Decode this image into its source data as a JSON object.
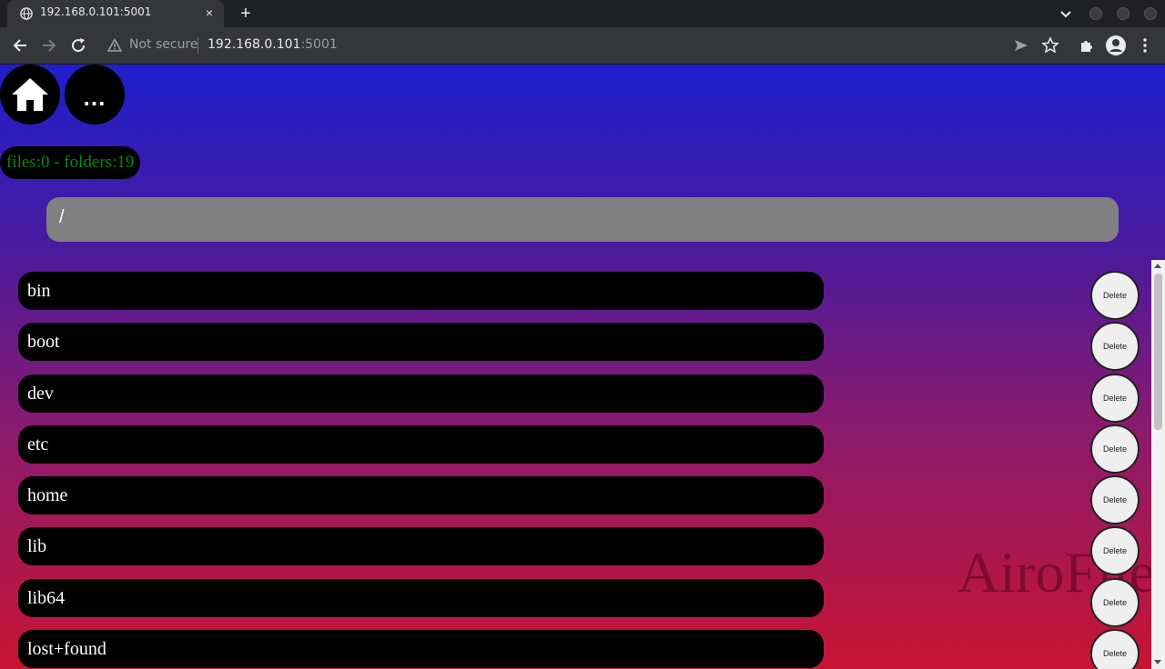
{
  "browser": {
    "tab_title": "192.168.0.101:5001",
    "tab_close": "×",
    "new_tab": "+",
    "security_label": "Not secure",
    "url_host": "192.168.0.101",
    "url_port": ":5001"
  },
  "app": {
    "more_label": "...",
    "counts": "files:0 - folders:19",
    "path": "/",
    "watermark": "AiroFile",
    "delete_label": "Delete",
    "folders": [
      {
        "name": "bin"
      },
      {
        "name": "boot"
      },
      {
        "name": "dev"
      },
      {
        "name": "etc"
      },
      {
        "name": "home"
      },
      {
        "name": "lib"
      },
      {
        "name": "lib64"
      },
      {
        "name": "lost+found"
      }
    ]
  },
  "colors": {
    "gradient_top": "#1e1fcc",
    "gradient_bottom": "#c81433",
    "counts_text": "#0a8a0a",
    "path_bar": "#808080"
  }
}
